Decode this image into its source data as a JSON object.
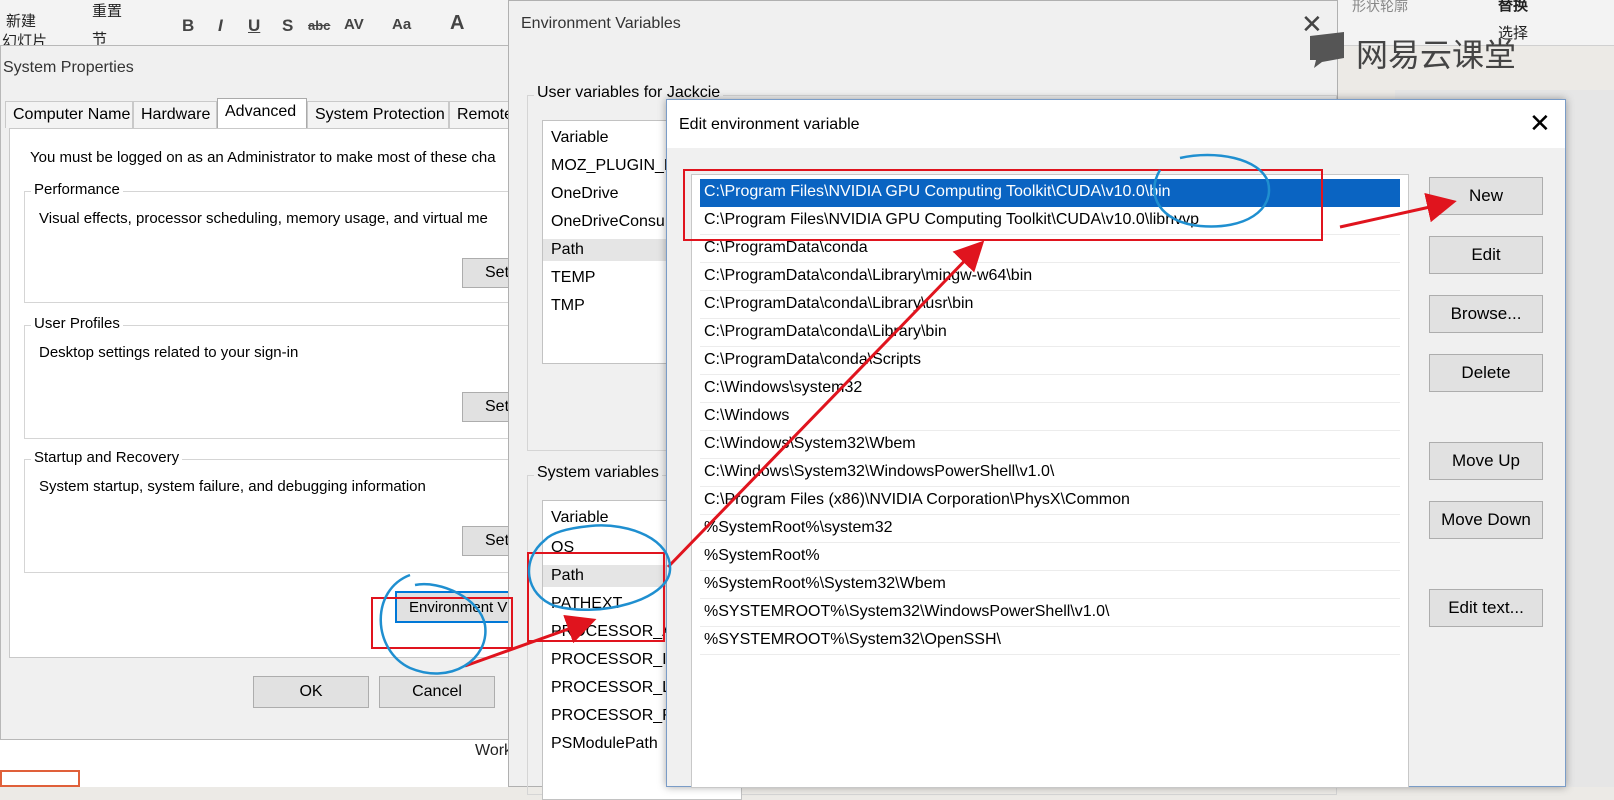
{
  "background_ribbon": {
    "new_label": "新建",
    "slide_label": "幻灯片",
    "reset_label": "重置",
    "section_label": "节",
    "format_items": [
      "B",
      "I",
      "U",
      "S",
      "abc",
      "AV",
      "Aa",
      "A"
    ],
    "right_top_label": "形状轮廓",
    "replace_label": "替换",
    "select_label": "选择",
    "doc_word": "Work"
  },
  "watermark": {
    "text": "网易云课堂"
  },
  "system_properties": {
    "title": "System Properties",
    "tabs": [
      "Computer Name",
      "Hardware",
      "Advanced",
      "System Protection",
      "Remote"
    ],
    "admin_note": "You must be logged on as an Administrator to make most of these cha",
    "performance": {
      "title": "Performance",
      "desc": "Visual effects, processor scheduling, memory usage, and virtual me",
      "button": "Set"
    },
    "user_profiles": {
      "title": "User Profiles",
      "desc": "Desktop settings related to your sign-in",
      "button": "Set"
    },
    "startup_recovery": {
      "title": "Startup and Recovery",
      "desc": "System startup, system failure, and debugging information",
      "button": "Set"
    },
    "env_button": "Environment V",
    "ok": "OK",
    "cancel": "Cancel"
  },
  "environment_variables": {
    "title": "Environment Variables",
    "close": "✕",
    "user_section": "User variables for Jackcie",
    "user_header": "Variable",
    "user_rows": [
      "MOZ_PLUGIN_P",
      "OneDrive",
      "OneDriveConsu",
      "Path",
      "TEMP",
      "TMP"
    ],
    "system_section": "System variables",
    "system_header": "Variable",
    "system_rows": [
      "OS",
      "Path",
      "PATHEXT",
      "PROCESSOR_A",
      "PROCESSOR_ID",
      "PROCESSOR_LE",
      "PROCESSOR_R",
      "PSModulePath"
    ]
  },
  "edit_env_var": {
    "title": "Edit environment variable",
    "close": "✕",
    "paths": [
      "C:\\Program Files\\NVIDIA GPU Computing Toolkit\\CUDA\\v10.0\\bin",
      "C:\\Program Files\\NVIDIA GPU Computing Toolkit\\CUDA\\v10.0\\libnvvp",
      "C:\\ProgramData\\conda",
      "C:\\ProgramData\\conda\\Library\\mingw-w64\\bin",
      "C:\\ProgramData\\conda\\Library\\usr\\bin",
      "C:\\ProgramData\\conda\\Library\\bin",
      "C:\\ProgramData\\conda\\Scripts",
      "C:\\Windows\\system32",
      "C:\\Windows",
      "C:\\Windows\\System32\\Wbem",
      "C:\\Windows\\System32\\WindowsPowerShell\\v1.0\\",
      "C:\\Program Files (x86)\\NVIDIA Corporation\\PhysX\\Common",
      "%SystemRoot%\\system32",
      "%SystemRoot%",
      "%SystemRoot%\\System32\\Wbem",
      "%SYSTEMROOT%\\System32\\WindowsPowerShell\\v1.0\\",
      "%SYSTEMROOT%\\System32\\OpenSSH\\"
    ],
    "buttons": {
      "new": "New",
      "edit": "Edit",
      "browse": "Browse...",
      "delete": "Delete",
      "move_up": "Move Up",
      "move_down": "Move Down",
      "edit_text": "Edit text..."
    }
  },
  "colors": {
    "annotation_red": "#e0141e",
    "annotation_blue": "#1f8fd0",
    "selection_blue": "#0a64c2"
  }
}
